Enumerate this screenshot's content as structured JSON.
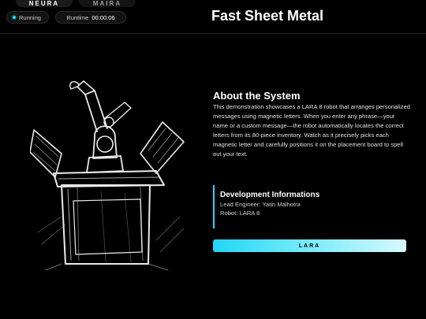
{
  "tabs": [
    {
      "label": "NEURA"
    },
    {
      "label": "MAIRA"
    }
  ],
  "status": {
    "label": "Running",
    "indicator_color": "#2bd4ff"
  },
  "runtime": {
    "label": "Runtime",
    "value": "00:00:06"
  },
  "page": {
    "title": "Fast Sheet Metal"
  },
  "about": {
    "title": "About the System",
    "text": "This demonstration showcases a LARA 8 robot that arranges personalized messages using magnetic letters. When you enter any phrase—your name or a custom message—the robot automatically locates the correct letters from its 80-piece inventory. Watch as it precisely picks each magnetic letter and carefully positions it on the placement board to spell out your text."
  },
  "development": {
    "title": "Development Informations",
    "lead": "Lead Engineer: Yatin Malhotra",
    "robot": "Robot: LARA 8"
  },
  "action": {
    "label": "LARA"
  },
  "colors": {
    "accent": "#2bd4ff",
    "background": "#000000"
  }
}
